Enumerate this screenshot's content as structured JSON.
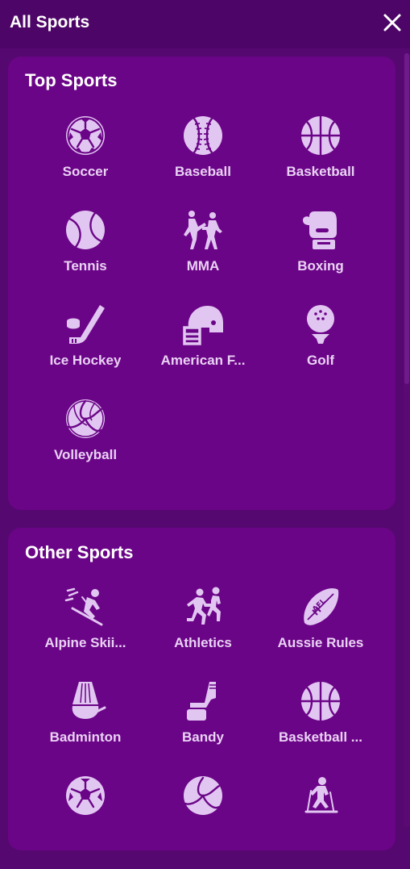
{
  "header": {
    "title": "All Sports"
  },
  "top_sports": {
    "title": "Top Sports",
    "items": [
      {
        "label": "Soccer",
        "icon": "soccer-ball-icon"
      },
      {
        "label": "Baseball",
        "icon": "baseball-icon"
      },
      {
        "label": "Basketball",
        "icon": "basketball-icon"
      },
      {
        "label": "Tennis",
        "icon": "tennis-ball-icon"
      },
      {
        "label": "MMA",
        "icon": "mma-fighters-icon"
      },
      {
        "label": "Boxing",
        "icon": "boxing-glove-icon"
      },
      {
        "label": "Ice Hockey",
        "icon": "ice-hockey-icon"
      },
      {
        "label": "American F...",
        "icon": "football-helmet-icon"
      },
      {
        "label": "Golf",
        "icon": "golf-ball-icon"
      },
      {
        "label": "Volleyball",
        "icon": "volleyball-icon"
      }
    ]
  },
  "other_sports": {
    "title": "Other Sports",
    "items": [
      {
        "label": "Alpine Skii...",
        "icon": "alpine-skiing-icon"
      },
      {
        "label": "Athletics",
        "icon": "athletics-runners-icon"
      },
      {
        "label": "Aussie Rules",
        "icon": "aussie-rules-ball-icon"
      },
      {
        "label": "Badminton",
        "icon": "shuttlecock-icon"
      },
      {
        "label": "Bandy",
        "icon": "bandy-icon"
      },
      {
        "label": "Basketball ...",
        "icon": "basketball-icon"
      },
      {
        "label": "",
        "icon": "soccer-ball-icon"
      },
      {
        "label": "",
        "icon": "volleyball-icon"
      },
      {
        "label": "",
        "icon": "biathlon-skier-icon"
      }
    ],
    "ball_text": "AFL"
  }
}
